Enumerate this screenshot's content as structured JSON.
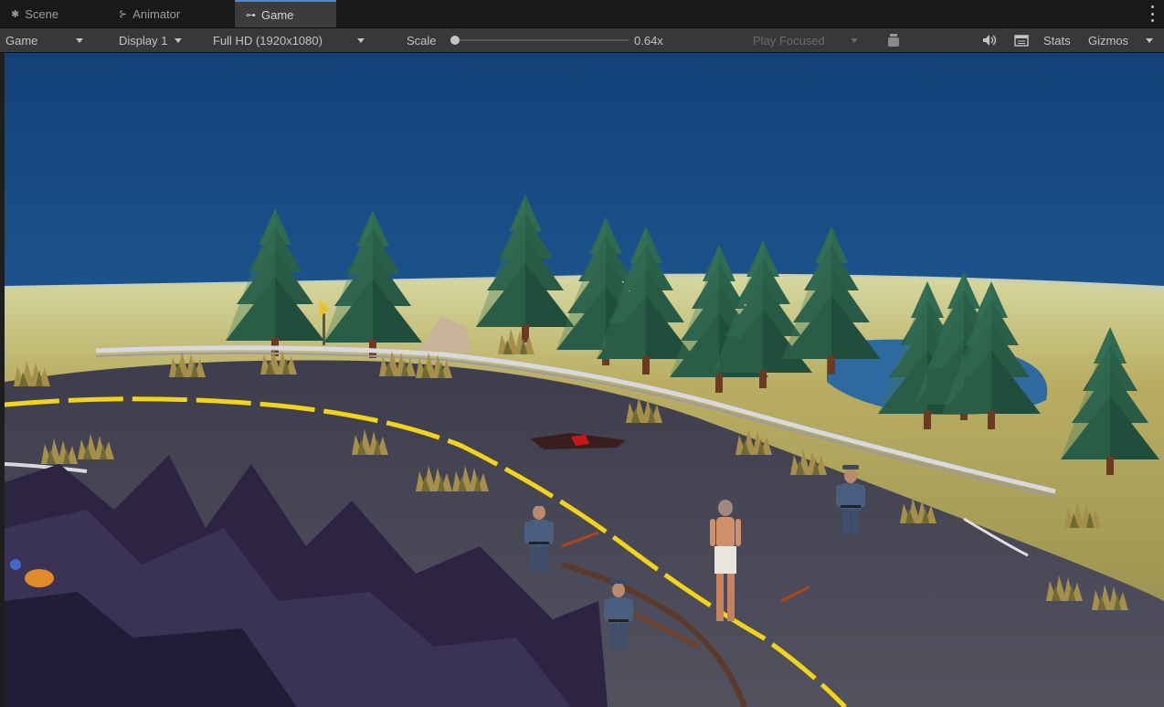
{
  "tabs": [
    {
      "label": "Scene",
      "icon": "scene-icon",
      "active": false
    },
    {
      "label": "Animator",
      "icon": "animator-icon",
      "active": false
    },
    {
      "label": "Game",
      "icon": "gamepad-icon",
      "active": true
    }
  ],
  "toolbar": {
    "view_mode": "Game",
    "display": "Display 1",
    "resolution": "Full HD (1920x1080)",
    "scale_label": "Scale",
    "scale_value": "0.64x",
    "play_mode": "Play Focused",
    "stats": "Stats",
    "gizmos": "Gizmos"
  },
  "colors": {
    "tab_active": "#3c3c3c",
    "toolbar": "#383838",
    "sky": "#174a80",
    "road": "#4a4a5a",
    "road_line": "#f2d41a",
    "grass": "#b3a85a"
  }
}
